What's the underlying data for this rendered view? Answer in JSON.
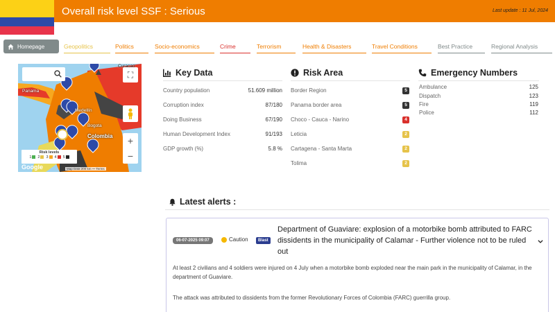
{
  "header": {
    "title": "Overall risk level SSF : Serious",
    "last_update": "Last update : 11 Jul, 2024",
    "flag_colors": [
      "#fcd116",
      "#2d4aa8",
      "#e8344b"
    ],
    "bar_color": "#ef7d00"
  },
  "nav": {
    "home_label": "Homepage",
    "tabs": [
      {
        "label": "Geopolitics",
        "color": "#e6c34a"
      },
      {
        "label": "Politics",
        "color": "#ef7d00"
      },
      {
        "label": "Socio-economics",
        "color": "#ef7d00"
      },
      {
        "label": "Crime",
        "color": "#d9302c"
      },
      {
        "label": "Terrorism",
        "color": "#ef7d00"
      },
      {
        "label": "Health & Disasters",
        "color": "#ef7d00"
      },
      {
        "label": "Travel Conditions",
        "color": "#ef7d00"
      },
      {
        "label": "Best Practice",
        "color": "#808a8a"
      },
      {
        "label": "Regional Analysis",
        "color": "#808a8a"
      }
    ]
  },
  "map": {
    "labels": [
      "Curaçao",
      "Panama",
      "Medellín",
      "Bogota",
      "Colombia"
    ],
    "legend_title": "Risk levels",
    "legend_levels": [
      {
        "n": "1",
        "color": "#4caf50"
      },
      {
        "n": "2",
        "color": "#e6c34a"
      },
      {
        "n": "3",
        "color": "#f5a623"
      },
      {
        "n": "4",
        "color": "#d9302c"
      },
      {
        "n": "5",
        "color": "#222222"
      }
    ],
    "google": "Google",
    "attribution": "Map Data   200 km ⎯⎯   Terms"
  },
  "key_data": {
    "title": "Key Data",
    "rows": [
      {
        "label": "Country population",
        "value": "51.609 million"
      },
      {
        "label": "Corruption index",
        "value": "87/180"
      },
      {
        "label": "Doing Business",
        "value": "67/190"
      },
      {
        "label": "Human Development Index",
        "value": "91/193"
      },
      {
        "label": "GDP growth (%)",
        "value": "5.8 %"
      }
    ]
  },
  "risk_area": {
    "title": "Risk Area",
    "rows": [
      {
        "label": "Border Region",
        "level": "5",
        "color": "#333333"
      },
      {
        "label": "Panama border area",
        "level": "5",
        "color": "#333333"
      },
      {
        "label": "Choco - Cauca - Narino",
        "level": "4",
        "color": "#d9302c"
      },
      {
        "label": "Leticia",
        "level": "2",
        "color": "#e6c34a"
      },
      {
        "label": "Cartagena - Santa Marta",
        "level": "2",
        "color": "#e6c34a"
      },
      {
        "label": "Tolima",
        "level": "2",
        "color": "#e6c34a"
      }
    ]
  },
  "emergency": {
    "title": "Emergency Numbers",
    "rows": [
      {
        "label": "Ambulance",
        "value": "125"
      },
      {
        "label": "Dispatch",
        "value": "123"
      },
      {
        "label": "Fire",
        "value": "119"
      },
      {
        "label": "Police",
        "value": "112"
      }
    ]
  },
  "alerts": {
    "title": "Latest alerts :",
    "items": [
      {
        "date": "06-07-2025 09:07",
        "level": "Caution",
        "tag": "Blast",
        "headline": "Department of Guaviare: explosion of a motorbike bomb attributed to FARC dissidents in the municipality of Calamar - Further violence not to be ruled out",
        "paragraphs": [
          "At least 2 civilians and 4 soldiers were injured on 4 July when a motorbike bomb exploded near the main park in the municipality of Calamar, in the department of Guaviare.",
          "The attack was attributed to dissidents from the former Revolutionary Forces of Colombia (FARC) guerrilla group."
        ]
      }
    ]
  }
}
